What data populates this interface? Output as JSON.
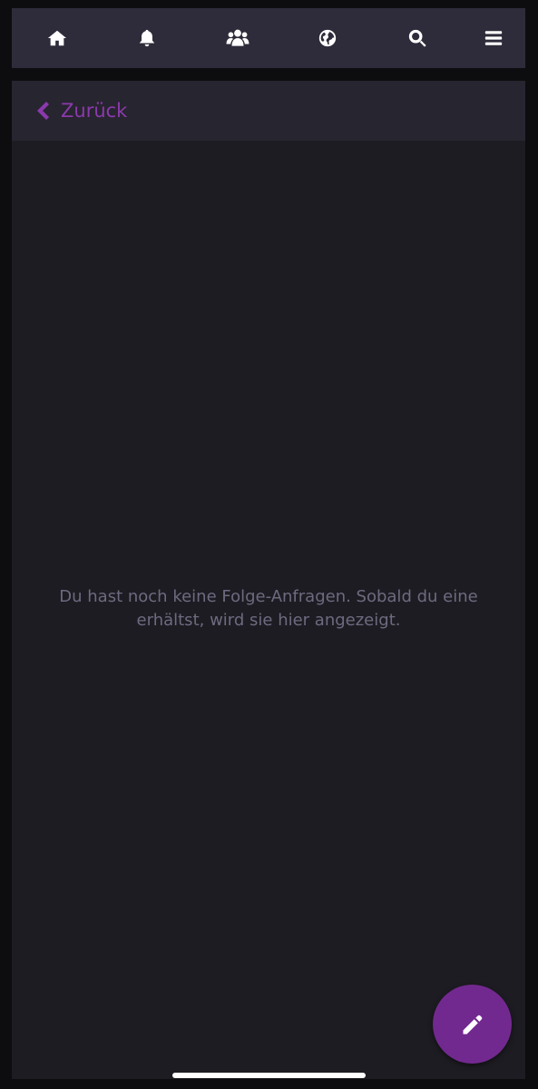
{
  "nav": {
    "items": [
      {
        "icon": "home-icon"
      },
      {
        "icon": "bell-icon"
      },
      {
        "icon": "users-icon"
      },
      {
        "icon": "globe-icon"
      },
      {
        "icon": "search-icon"
      },
      {
        "icon": "menu-icon"
      }
    ]
  },
  "back": {
    "label": "Zurück",
    "icon": "chevron-left-icon"
  },
  "empty_state": {
    "message": "Du hast noch keine Folge-Anfragen. Sobald du eine erhältst, wird sie hier angezeigt."
  },
  "fab": {
    "icon": "pencil-icon"
  },
  "colors": {
    "accent": "#8b39ad",
    "fab": "#72298f",
    "topbar": "#2e2c3a",
    "panel": "#1d1c22",
    "muted_text": "#6e6a80"
  }
}
